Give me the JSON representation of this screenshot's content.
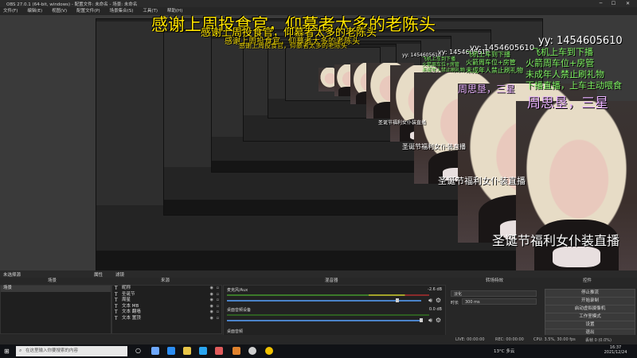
{
  "window": {
    "title": "OBS 27.0.1 (64-bit, windows) - 配置文件: 未命名 - 场景: 未命名",
    "controls": {
      "minimize": "─",
      "maximize": "☐",
      "close": "✕"
    }
  },
  "menu": [
    "文件(F)",
    "编辑(E)",
    "视图(V)",
    "配置文件(P)",
    "场景集合(S)",
    "工具(T)",
    "帮助(H)"
  ],
  "overlay": {
    "title_line": "感谢上周投食官，仰慕者太多的老陈头",
    "title_line_small": "感谢上周投食官，仰慕者太多的老陈头",
    "yy_id": "yy: 1454605610",
    "rules": [
      "飞机上车到下播",
      "火箭周车位+房管",
      "未成年人禁止刷礼物",
      "下播直播，上车主动喂食"
    ],
    "name_tag": "周思垦，三星",
    "caption": "圣诞节福利女仆装直播"
  },
  "docks": {
    "scenes_title": "场景",
    "sources_title": "来源",
    "mixer_title": "混音器",
    "transitions_title": "转场特效",
    "controls_title": "控件",
    "left_header": "未选择源",
    "left_props": "属性",
    "left_filters": "滤镜",
    "scene_item": "场景",
    "sources": [
      {
        "icon": "T",
        "name": "昵称"
      },
      {
        "icon": "T",
        "name": "圣诞节"
      },
      {
        "icon": "T",
        "name": "周星"
      },
      {
        "icon": "T",
        "name": "文本 MB"
      },
      {
        "icon": "T",
        "name": "文本 翻墙"
      },
      {
        "icon": "T",
        "name": "文本 置顶"
      }
    ],
    "mixer": [
      {
        "name": "麦克风/Aux",
        "db": "-2.6 dB"
      },
      {
        "name": "桌面音频设备",
        "db": "0.0 dB"
      }
    ],
    "mixer_bottom_label": "桌面音频",
    "transition": {
      "type": "淡化",
      "duration_label": "时长",
      "duration": "300 ms"
    },
    "control_buttons": [
      "停止推流",
      "开始录制",
      "启动虚拟摄像机",
      "工作室模式",
      "设置",
      "退出"
    ]
  },
  "status": {
    "live": "LIVE: 00:00:00",
    "rec": "REC: 00:00:00",
    "cpu": "CPU: 3.5%, 30.00 fps",
    "dropped": "丢帧 0 (0.0%)"
  },
  "taskbar": {
    "search_placeholder": "在这里输入你要搜索的内容",
    "weather": "13°C 多云",
    "time": "16:37",
    "date": "2021/12/24",
    "app_colors": [
      "#6ea8ff",
      "#2b8df2",
      "#e8c547",
      "#2aa5f0",
      "#e05b5b",
      "#e0822d",
      "#cfcfcf",
      "#f2c200"
    ]
  }
}
